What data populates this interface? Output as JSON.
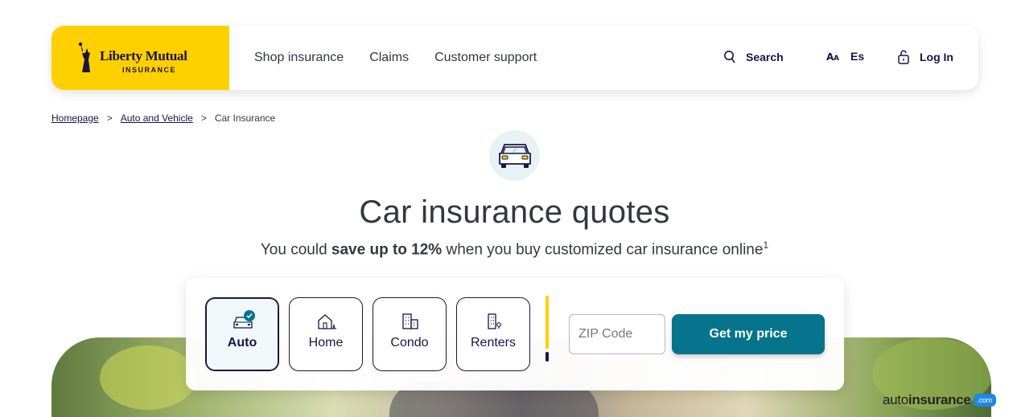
{
  "header": {
    "logo": {
      "name": "Liberty Mutual",
      "tagline": "INSURANCE"
    },
    "nav": [
      "Shop insurance",
      "Claims",
      "Customer support"
    ],
    "search_label": "Search",
    "language_label": "Es",
    "login_label": "Log In"
  },
  "breadcrumb": {
    "items": [
      "Homepage",
      "Auto and Vehicle",
      "Car Insurance"
    ],
    "separator": ">"
  },
  "hero": {
    "title": "Car insurance quotes",
    "subtitle_pre": "You could ",
    "subtitle_bold": "save up to 12%",
    "subtitle_post": " when you buy customized car insurance online",
    "footnote": "1"
  },
  "quote": {
    "options": [
      {
        "label": "Auto",
        "icon": "car-icon",
        "selected": true
      },
      {
        "label": "Home",
        "icon": "house-icon",
        "selected": false
      },
      {
        "label": "Condo",
        "icon": "condo-building-icon",
        "selected": false
      },
      {
        "label": "Renters",
        "icon": "renters-building-icon",
        "selected": false
      }
    ],
    "zip_placeholder": "ZIP Code",
    "zip_value": "",
    "cta_label": "Get my price"
  },
  "watermark": {
    "part1": "auto",
    "part2": "insurance",
    "badge": ".com"
  },
  "colors": {
    "brand_yellow": "#ffd000",
    "brand_navy": "#1a1446",
    "cta_teal": "#06748c"
  }
}
